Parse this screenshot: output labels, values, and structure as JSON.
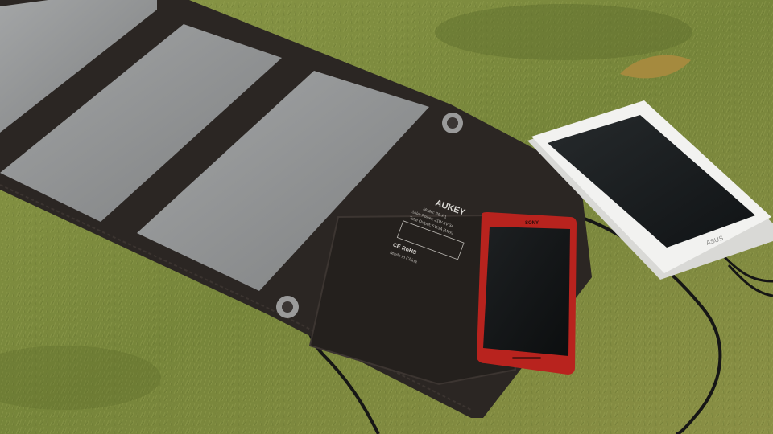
{
  "panel": {
    "brand": "AUKEY",
    "model": "Model: PB-P1",
    "spec_line_1": "Solar Power: 21W 5V 3A",
    "spec_line_2": "Total Output: 5V/3A (Max)",
    "certifications": "CE RoHS",
    "origin": "Made in China"
  },
  "phone": {
    "brand": "SONY"
  },
  "tablet": {
    "brand": "ASUS"
  },
  "colors": {
    "grass": "#7d8a3f",
    "fabric": "#2b2623",
    "solar_cell": "#8f9192",
    "phone_body": "#b8231e",
    "tablet_body": "#f2f2f0"
  }
}
